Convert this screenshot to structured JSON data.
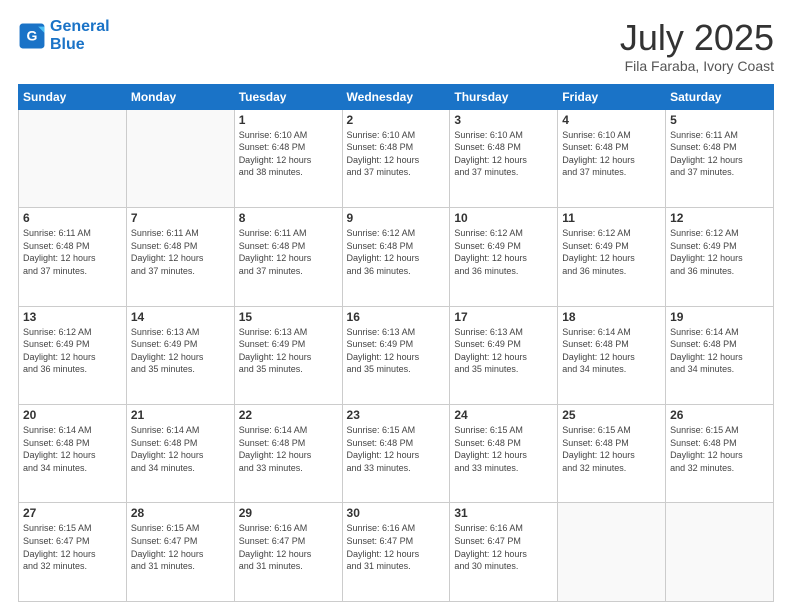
{
  "header": {
    "logo_line1": "General",
    "logo_line2": "Blue",
    "month_year": "July 2025",
    "location": "Fila Faraba, Ivory Coast"
  },
  "weekdays": [
    "Sunday",
    "Monday",
    "Tuesday",
    "Wednesday",
    "Thursday",
    "Friday",
    "Saturday"
  ],
  "weeks": [
    [
      {
        "day": "",
        "info": ""
      },
      {
        "day": "",
        "info": ""
      },
      {
        "day": "1",
        "info": "Sunrise: 6:10 AM\nSunset: 6:48 PM\nDaylight: 12 hours\nand 38 minutes."
      },
      {
        "day": "2",
        "info": "Sunrise: 6:10 AM\nSunset: 6:48 PM\nDaylight: 12 hours\nand 37 minutes."
      },
      {
        "day": "3",
        "info": "Sunrise: 6:10 AM\nSunset: 6:48 PM\nDaylight: 12 hours\nand 37 minutes."
      },
      {
        "day": "4",
        "info": "Sunrise: 6:10 AM\nSunset: 6:48 PM\nDaylight: 12 hours\nand 37 minutes."
      },
      {
        "day": "5",
        "info": "Sunrise: 6:11 AM\nSunset: 6:48 PM\nDaylight: 12 hours\nand 37 minutes."
      }
    ],
    [
      {
        "day": "6",
        "info": "Sunrise: 6:11 AM\nSunset: 6:48 PM\nDaylight: 12 hours\nand 37 minutes."
      },
      {
        "day": "7",
        "info": "Sunrise: 6:11 AM\nSunset: 6:48 PM\nDaylight: 12 hours\nand 37 minutes."
      },
      {
        "day": "8",
        "info": "Sunrise: 6:11 AM\nSunset: 6:48 PM\nDaylight: 12 hours\nand 37 minutes."
      },
      {
        "day": "9",
        "info": "Sunrise: 6:12 AM\nSunset: 6:48 PM\nDaylight: 12 hours\nand 36 minutes."
      },
      {
        "day": "10",
        "info": "Sunrise: 6:12 AM\nSunset: 6:49 PM\nDaylight: 12 hours\nand 36 minutes."
      },
      {
        "day": "11",
        "info": "Sunrise: 6:12 AM\nSunset: 6:49 PM\nDaylight: 12 hours\nand 36 minutes."
      },
      {
        "day": "12",
        "info": "Sunrise: 6:12 AM\nSunset: 6:49 PM\nDaylight: 12 hours\nand 36 minutes."
      }
    ],
    [
      {
        "day": "13",
        "info": "Sunrise: 6:12 AM\nSunset: 6:49 PM\nDaylight: 12 hours\nand 36 minutes."
      },
      {
        "day": "14",
        "info": "Sunrise: 6:13 AM\nSunset: 6:49 PM\nDaylight: 12 hours\nand 35 minutes."
      },
      {
        "day": "15",
        "info": "Sunrise: 6:13 AM\nSunset: 6:49 PM\nDaylight: 12 hours\nand 35 minutes."
      },
      {
        "day": "16",
        "info": "Sunrise: 6:13 AM\nSunset: 6:49 PM\nDaylight: 12 hours\nand 35 minutes."
      },
      {
        "day": "17",
        "info": "Sunrise: 6:13 AM\nSunset: 6:49 PM\nDaylight: 12 hours\nand 35 minutes."
      },
      {
        "day": "18",
        "info": "Sunrise: 6:14 AM\nSunset: 6:48 PM\nDaylight: 12 hours\nand 34 minutes."
      },
      {
        "day": "19",
        "info": "Sunrise: 6:14 AM\nSunset: 6:48 PM\nDaylight: 12 hours\nand 34 minutes."
      }
    ],
    [
      {
        "day": "20",
        "info": "Sunrise: 6:14 AM\nSunset: 6:48 PM\nDaylight: 12 hours\nand 34 minutes."
      },
      {
        "day": "21",
        "info": "Sunrise: 6:14 AM\nSunset: 6:48 PM\nDaylight: 12 hours\nand 34 minutes."
      },
      {
        "day": "22",
        "info": "Sunrise: 6:14 AM\nSunset: 6:48 PM\nDaylight: 12 hours\nand 33 minutes."
      },
      {
        "day": "23",
        "info": "Sunrise: 6:15 AM\nSunset: 6:48 PM\nDaylight: 12 hours\nand 33 minutes."
      },
      {
        "day": "24",
        "info": "Sunrise: 6:15 AM\nSunset: 6:48 PM\nDaylight: 12 hours\nand 33 minutes."
      },
      {
        "day": "25",
        "info": "Sunrise: 6:15 AM\nSunset: 6:48 PM\nDaylight: 12 hours\nand 32 minutes."
      },
      {
        "day": "26",
        "info": "Sunrise: 6:15 AM\nSunset: 6:48 PM\nDaylight: 12 hours\nand 32 minutes."
      }
    ],
    [
      {
        "day": "27",
        "info": "Sunrise: 6:15 AM\nSunset: 6:47 PM\nDaylight: 12 hours\nand 32 minutes."
      },
      {
        "day": "28",
        "info": "Sunrise: 6:15 AM\nSunset: 6:47 PM\nDaylight: 12 hours\nand 31 minutes."
      },
      {
        "day": "29",
        "info": "Sunrise: 6:16 AM\nSunset: 6:47 PM\nDaylight: 12 hours\nand 31 minutes."
      },
      {
        "day": "30",
        "info": "Sunrise: 6:16 AM\nSunset: 6:47 PM\nDaylight: 12 hours\nand 31 minutes."
      },
      {
        "day": "31",
        "info": "Sunrise: 6:16 AM\nSunset: 6:47 PM\nDaylight: 12 hours\nand 30 minutes."
      },
      {
        "day": "",
        "info": ""
      },
      {
        "day": "",
        "info": ""
      }
    ]
  ]
}
